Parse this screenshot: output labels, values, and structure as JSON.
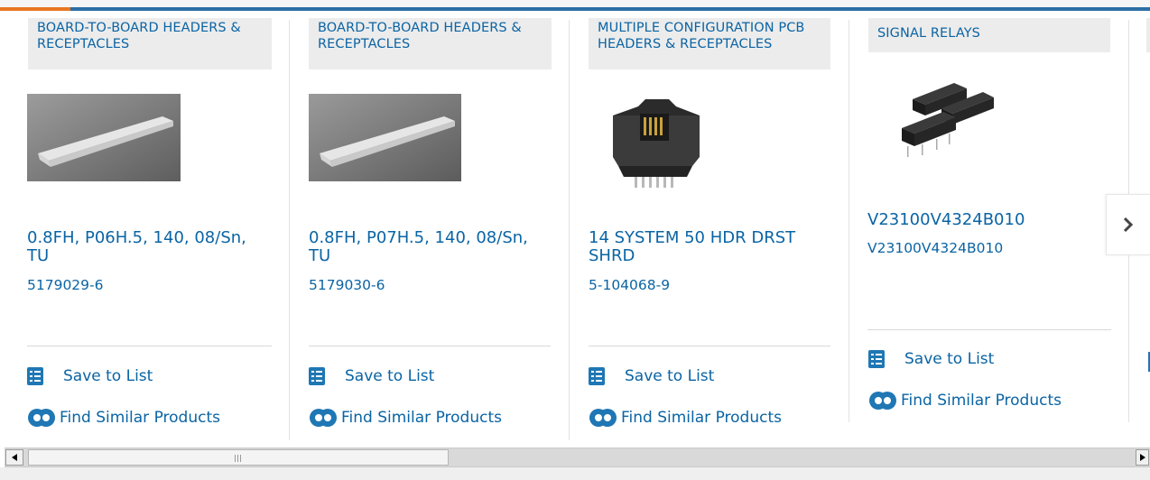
{
  "products": [
    {
      "category": "BOARD-TO-BOARD HEADERS & RECEPTACLES",
      "title": "0.8FH, P06H.5, 140, 08/Sn, TU",
      "part_number": "5179029-6",
      "image_icon": "board-connector-image"
    },
    {
      "category": "BOARD-TO-BOARD HEADERS & RECEPTACLES",
      "title": "0.8FH, P07H.5, 140, 08/Sn, TU",
      "part_number": "5179030-6",
      "image_icon": "board-connector-image"
    },
    {
      "category": "MULTIPLE CONFIGURATION PCB HEADERS & RECEPTACLES",
      "title": "14 SYSTEM 50 HDR DRST SHRD",
      "part_number": "5-104068-9",
      "image_icon": "pcb-header-image"
    },
    {
      "category": "SIGNAL RELAYS",
      "title": "V23100V4324B010",
      "part_number": "V23100V4324B010",
      "image_icon": "signal-relay-image"
    }
  ],
  "actions": {
    "save_label": "Save to List",
    "similar_label": "Find Similar Products"
  },
  "colors": {
    "link": "#0a64a4",
    "accent_orange": "#e87722",
    "accent_blue": "#2d6ea5",
    "category_bg": "#ececec"
  }
}
